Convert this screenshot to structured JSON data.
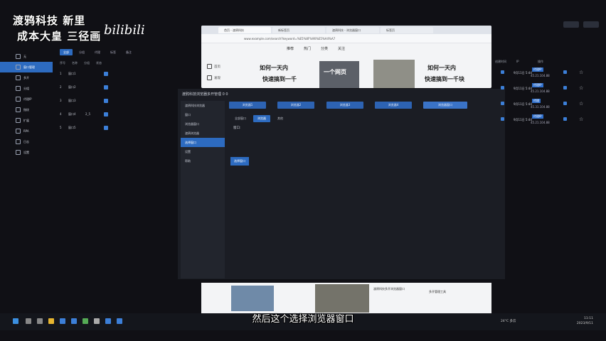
{
  "watermark": {
    "line1": "渡鸦科技 新里",
    "line2": "成本大皇 三径画",
    "signature": "bilibili"
  },
  "sidebar": {
    "items": [
      {
        "label": "无",
        "active": false
      },
      {
        "label": "窗口管理",
        "active": true
      },
      {
        "label": "多开",
        "active": false
      },
      {
        "label": "分组",
        "active": false
      },
      {
        "label": "代理IP",
        "active": false
      },
      {
        "label": "指纹",
        "active": false
      },
      {
        "label": "扩展",
        "active": false
      },
      {
        "label": "RPA",
        "active": false
      },
      {
        "label": "日志",
        "active": false
      },
      {
        "label": "设置",
        "active": false
      }
    ]
  },
  "main_tabs": [
    "全部",
    "分组",
    "代理",
    "标签",
    "备注"
  ],
  "left_table": {
    "headers": [
      "序号",
      "名称",
      "分组",
      "状态"
    ],
    "rows": [
      [
        "1",
        "窗口1",
        "",
        ""
      ],
      [
        "2",
        "窗口2",
        "",
        ""
      ],
      [
        "3",
        "窗口3",
        "",
        ""
      ],
      [
        "4",
        "窗口4",
        "2_5",
        ""
      ],
      [
        "5",
        "窗口5",
        "",
        ""
      ]
    ]
  },
  "browser": {
    "tabs": [
      "首页 - 渡鸦科技",
      "新标签页",
      "渡鸦科技 - 浏览器窗口",
      "标签页"
    ],
    "url": "www.example.com/search?keyword=%E5%8F%96%E5%A4%A7",
    "site_nav": [
      "推荐",
      "热门",
      "分类",
      "关注"
    ],
    "sidebar_links": [
      "首页",
      "发现"
    ],
    "banner_left_line1": "如何一天内",
    "banner_left_line2": "快速搞到一千",
    "banner_mid": "一个网页",
    "banner_right_line1": "如何一天内",
    "banner_right_line2": "快速搞到一千块"
  },
  "dialog": {
    "title": "渡鸦科技浏览器多开管理 0 0",
    "sidebar_items": [
      {
        "label": "渡鸦科技浏览器",
        "active": false
      },
      {
        "label": "窗口",
        "active": false
      },
      {
        "label": "浏览器窗口",
        "active": false
      },
      {
        "label": "渡鸦浏览器",
        "active": false
      },
      {
        "label": "选择窗口",
        "active": true
      },
      {
        "label": "设置",
        "active": false
      },
      {
        "label": "帮助",
        "active": false
      }
    ],
    "window_buttons": [
      "浏览器1",
      "浏览器2",
      "浏览器3",
      "浏览器4",
      "浏览器窗口"
    ],
    "subtabs": [
      "全部窗口",
      "浏览器",
      "其他"
    ],
    "field_label": "窗口:",
    "confirm_label": "选择窗口"
  },
  "right_table": {
    "headers": [
      "创建时间",
      "IP",
      "操作"
    ],
    "rows": [
      {
        "time": "9月11日 5:44",
        "badge": "代理IP",
        "ip": "45.21.104.88"
      },
      {
        "time": "9月11日 5:44",
        "badge": "代理IP",
        "ip": "45.21.104.88"
      },
      {
        "time": "9月11日 5:44",
        "badge": "代理",
        "ip": "45.31.104.88"
      },
      {
        "time": "9月11日 5:44",
        "badge": "代理IP",
        "ip": "45.21.104.88"
      }
    ]
  },
  "bottom_browser": {
    "caption1": "渡鸦科技多开浏览器窗口",
    "caption2": "多开管理工具"
  },
  "subtitle": "然后这个选择浏览器窗口",
  "taskbar": {
    "weather": "24°C 多云",
    "time": "11:11",
    "date": "2023/9/11"
  },
  "colors": {
    "accent": "#2d6bc0",
    "bg": "#101015"
  }
}
